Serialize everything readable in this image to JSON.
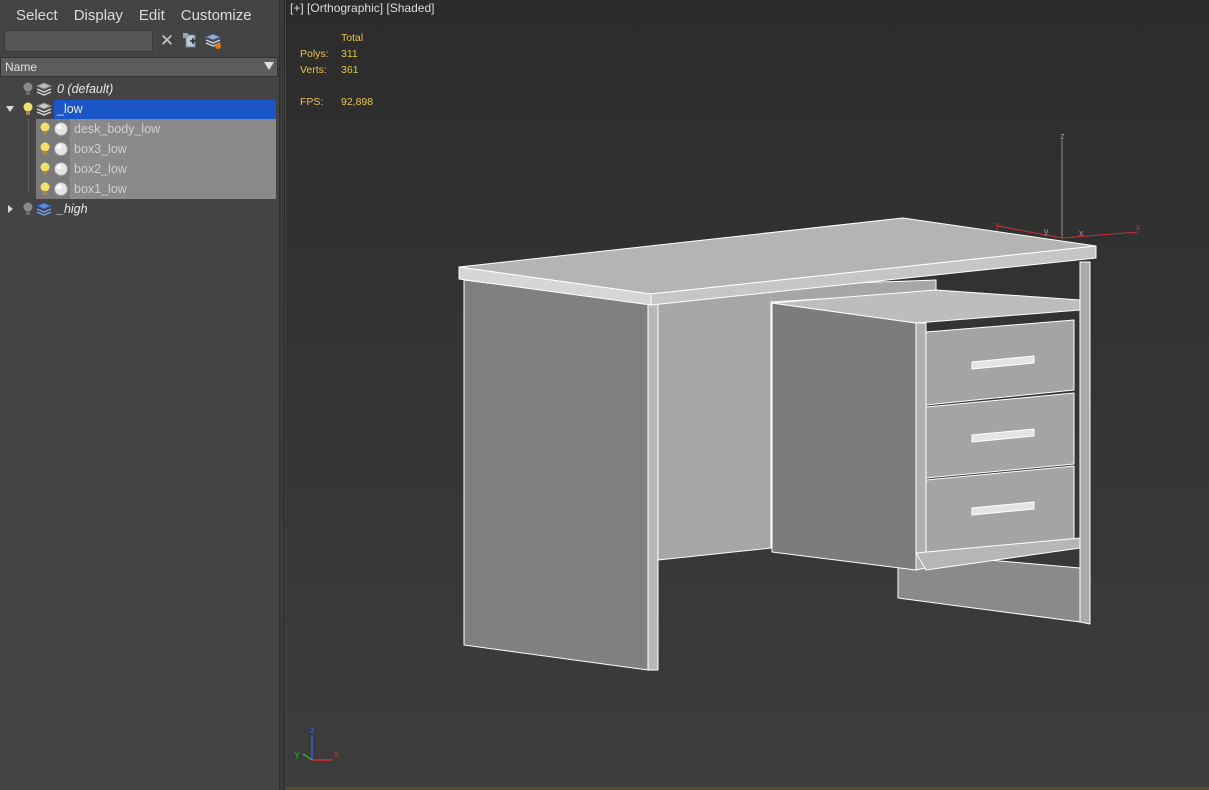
{
  "menu": [
    "Select",
    "Display",
    "Edit",
    "Customize"
  ],
  "search": {
    "value": "",
    "placeholder": ""
  },
  "column_header": "Name",
  "tree": [
    {
      "label": "0 (default)",
      "italic": true,
      "expanded": null,
      "level": 0
    },
    {
      "label": "_low",
      "italic": false,
      "expanded": true,
      "level": 0,
      "selected": true
    },
    {
      "label": "desk_body_low",
      "level": 1
    },
    {
      "label": "box3_low",
      "level": 1
    },
    {
      "label": "box2_low",
      "level": 1
    },
    {
      "label": "box1_low",
      "level": 1
    },
    {
      "label": "_high",
      "italic": true,
      "expanded": false,
      "level": 0
    }
  ],
  "viewport": {
    "label_parts": [
      "[+]",
      "[Orthographic]",
      "[Shaded]"
    ],
    "stats": {
      "header": "Total",
      "polys_label": "Polys:",
      "polys_value": "311",
      "verts_label": "Verts:",
      "verts_value": "361",
      "fps_label": "FPS:",
      "fps_value": "92,898"
    },
    "gizmo_labels": {
      "z": "z",
      "y": "y",
      "x": "x"
    },
    "tripod_labels": {
      "z": "z",
      "y": "y",
      "x": "x"
    }
  },
  "colors": {
    "selection": "#1a56c8",
    "child_highlight": "#7a7a7a",
    "stats_text": "#e6c24a",
    "axis_x": "#d03030",
    "axis_y": "#30b030",
    "axis_z": "#3060e0"
  },
  "icons": {
    "clear": "close-icon",
    "find": "select-object-icon",
    "layer": "layer-manager-icon",
    "bulb": "light-bulb-icon",
    "layer_stack": "layer-stack-icon",
    "object": "sphere-object-icon"
  }
}
